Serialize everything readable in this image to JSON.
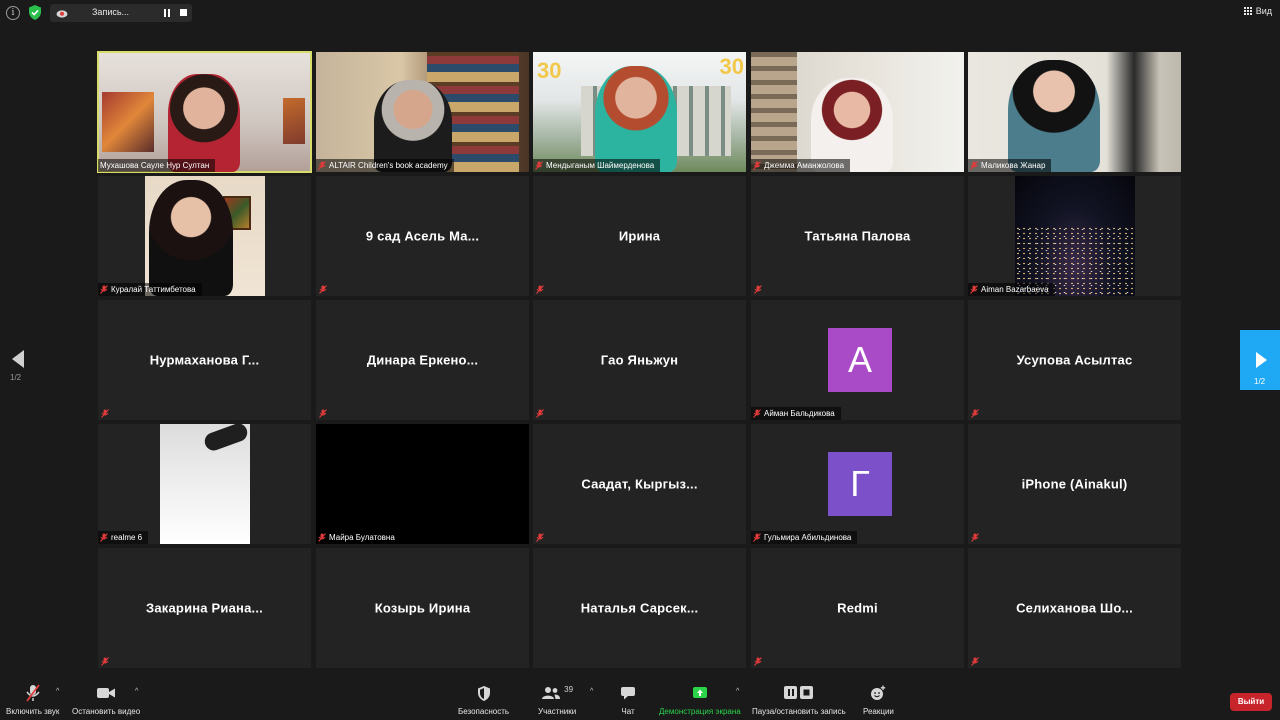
{
  "top_bar": {
    "recording_label": "Запись...",
    "view_label": "Вид"
  },
  "tiles": [
    {
      "name": "Мухашова Сауле Нур Султан",
      "kind": "video",
      "muted": false,
      "speaking": true
    },
    {
      "name": "ALTAIR Children's book academy",
      "kind": "video",
      "muted": true
    },
    {
      "name": "Мендыганым Шаймерденова",
      "kind": "video",
      "muted": true
    },
    {
      "name": "Джемма Аманжолова",
      "kind": "video",
      "muted": true
    },
    {
      "name": "Маликова Жанар",
      "kind": "video",
      "muted": true
    },
    {
      "name": "Куралай Таттимбетова",
      "kind": "video",
      "muted": true
    },
    {
      "name": "9 сад Асель Ма...",
      "kind": "name",
      "muted": true
    },
    {
      "name": "Ирина",
      "kind": "name",
      "muted": true
    },
    {
      "name": "Татьяна Палова",
      "kind": "name",
      "muted": true
    },
    {
      "name": "Aiman Bazarbaeva",
      "kind": "video",
      "muted": true
    },
    {
      "name": "Нурмаханова Г...",
      "kind": "name",
      "muted": true
    },
    {
      "name": "Динара Еркено...",
      "kind": "name",
      "muted": true
    },
    {
      "name": "Гао Яньжун",
      "kind": "name",
      "muted": true
    },
    {
      "name": "Айман Бальдикова",
      "kind": "avatar",
      "letter": "А",
      "color": "#a94bc7",
      "muted": true
    },
    {
      "name": "Усупова Асылтас",
      "kind": "name",
      "muted": true
    },
    {
      "name": "realme 6",
      "kind": "video",
      "muted": true
    },
    {
      "name": "Майра Булатовна",
      "kind": "black",
      "muted": false
    },
    {
      "name": "Саадат, Кыргыз...",
      "kind": "name",
      "muted": true
    },
    {
      "name": "Гульмира Абильдинова",
      "kind": "avatar",
      "letter": "Г",
      "color": "#7b50c9",
      "muted": true
    },
    {
      "name": "iPhone (Ainakul)",
      "kind": "name",
      "muted": true
    },
    {
      "name": "Закарина Риана...",
      "kind": "name",
      "muted": true
    },
    {
      "name": "Козырь Ирина",
      "kind": "name",
      "muted": true
    },
    {
      "name": "Наталья Сарсек...",
      "kind": "name",
      "muted": true
    },
    {
      "name": "Redmi",
      "kind": "name",
      "muted": true
    },
    {
      "name": "Селиханова Шо...",
      "kind": "name",
      "muted": true
    }
  ],
  "pagination": {
    "left": "1/2",
    "right": "1/2"
  },
  "toolbar": {
    "unmute_label": "Включить звук",
    "video_label": "Остановить видео",
    "security_label": "Безопасность",
    "participants_label": "Участники",
    "participants_count": "39",
    "chat_label": "Чат",
    "share_label": "Демонстрация экрана",
    "record_label": "Пауза/остановить запись",
    "reactions_label": "Реакции",
    "leave_label": "Выйти"
  },
  "colors": {
    "background": "#1a1a1a",
    "tile": "#232323",
    "active_speaker": "#d8dc6a",
    "nav_accent": "#1fa8f3",
    "share_green": "#2bd34b",
    "leave_red": "#c8242b"
  }
}
